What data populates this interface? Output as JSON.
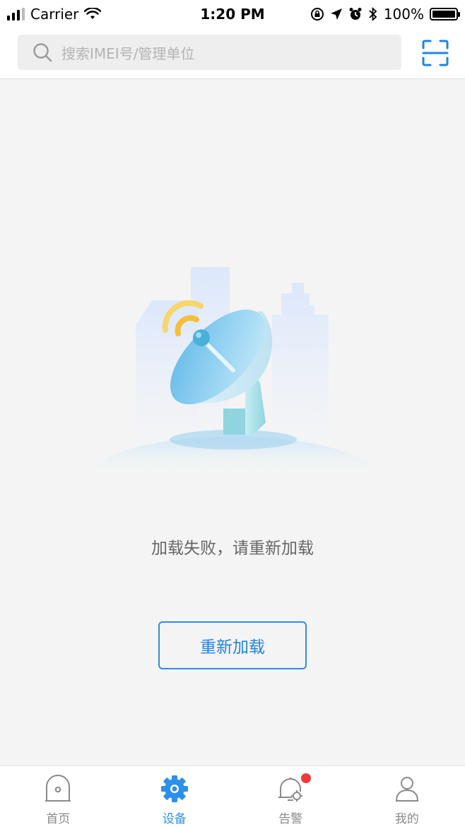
{
  "status_bar": {
    "carrier": "Carrier",
    "time": "1:20 PM",
    "battery": "100%",
    "icons": [
      "signal-icon",
      "wifi-icon",
      "orientation-lock-icon",
      "location-icon",
      "alarm-icon",
      "bluetooth-icon",
      "battery-icon"
    ]
  },
  "search": {
    "placeholder": "搜索IMEI号/管理单位",
    "scan_icon": "scan-icon"
  },
  "empty_state": {
    "message": "加载失败，请重新加载",
    "reload_label": "重新加载",
    "illustration": "satellite-dish-illustration"
  },
  "tabs": [
    {
      "label": "首页",
      "icon": "home-icon",
      "active": false
    },
    {
      "label": "设备",
      "icon": "device-gear-icon",
      "active": true
    },
    {
      "label": "告警",
      "icon": "alarm-bell-icon",
      "active": false,
      "badge": true
    },
    {
      "label": "我的",
      "icon": "user-icon",
      "active": false
    }
  ],
  "colors": {
    "accent": "#2c8ff0",
    "background": "#f4f4f4",
    "badge": "#f03a3a"
  }
}
